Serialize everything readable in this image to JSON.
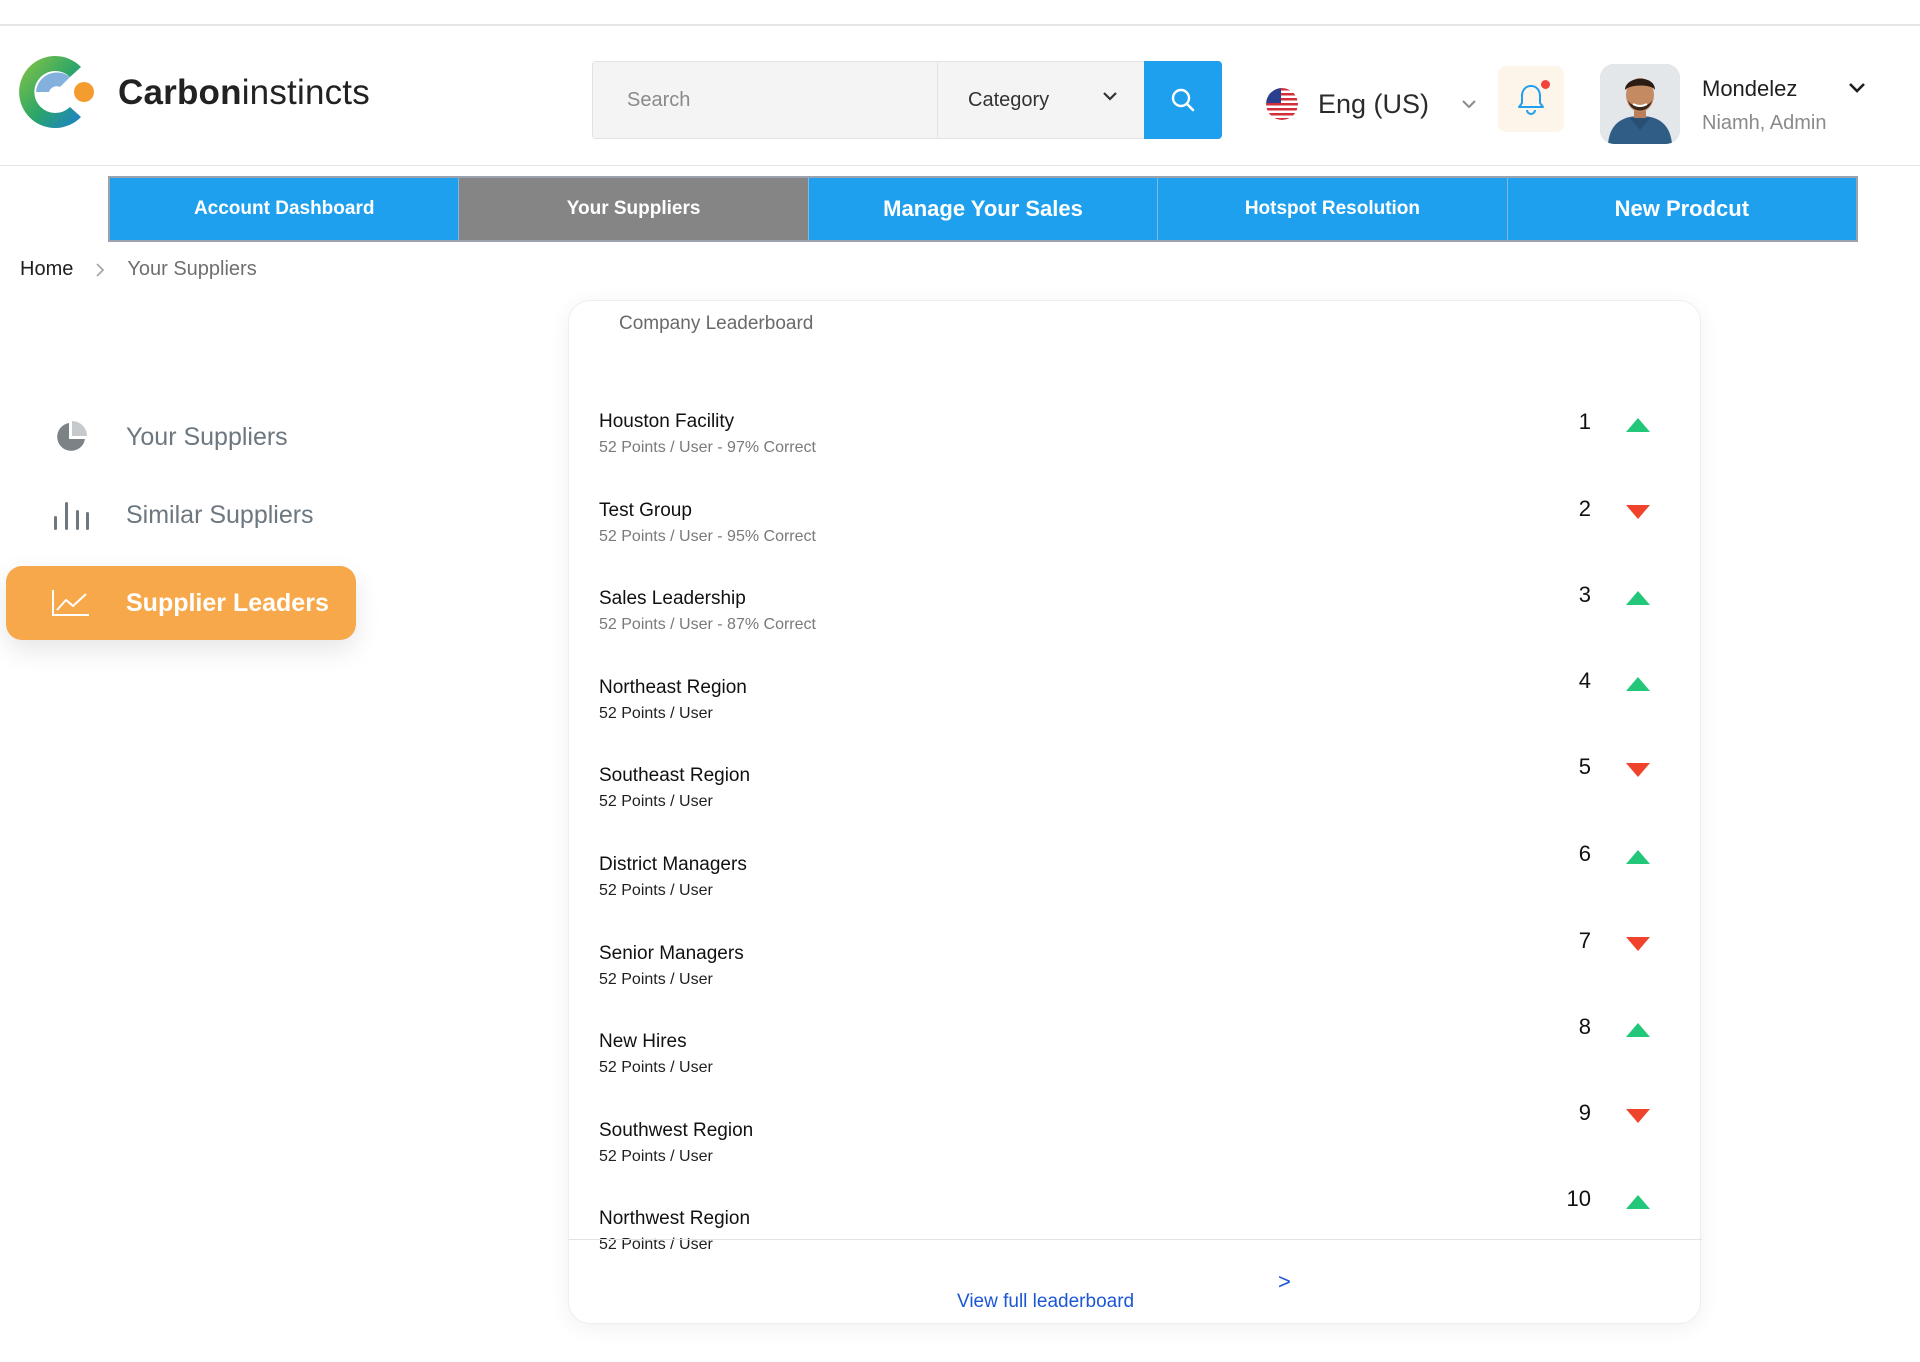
{
  "brand": {
    "name_bold": "Carbon",
    "name_light": "instincts"
  },
  "search": {
    "placeholder": "Search",
    "category_label": "Category"
  },
  "language": {
    "label": "Eng (US)"
  },
  "user": {
    "name": "Mondelez",
    "role": "Niamh, Admin"
  },
  "nav": {
    "tabs": [
      {
        "label": "Account Dashboard",
        "active": false
      },
      {
        "label": "Your Suppliers",
        "active": true
      },
      {
        "label": "Manage Your Sales",
        "active": false
      },
      {
        "label": "Hotspot Resolution",
        "active": false
      },
      {
        "label": "New Prodcut",
        "active": false
      }
    ]
  },
  "breadcrumb": {
    "home": "Home",
    "separator": ">",
    "current": "Your Suppliers"
  },
  "sidebar": {
    "items": [
      {
        "label": "Your Suppliers",
        "icon": "pie-chart-icon",
        "active": false
      },
      {
        "label": "Similar Suppliers",
        "icon": "bar-chart-icon",
        "active": false
      },
      {
        "label": "Supplier Leaders",
        "icon": "line-chart-icon",
        "active": true
      }
    ]
  },
  "leaderboard": {
    "title": "Company Leaderboard",
    "rows": [
      {
        "name": "Houston Facility",
        "meta": "52 Points / User - 97% Correct",
        "rank": "1",
        "trend": "up"
      },
      {
        "name": "Test Group",
        "meta": "52 Points / User - 95% Correct",
        "rank": "2",
        "trend": "down"
      },
      {
        "name": "Sales Leadership",
        "meta": "52 Points / User -  87% Correct",
        "rank": "3",
        "trend": "up"
      },
      {
        "name": "Northeast Region",
        "meta": "52 Points / User",
        "rank": "4",
        "trend": "up"
      },
      {
        "name": "Southeast Region",
        "meta": "52 Points / User",
        "rank": "5",
        "trend": "down"
      },
      {
        "name": "District Managers",
        "meta": "52 Points / User",
        "rank": "6",
        "trend": "up"
      },
      {
        "name": "Senior Managers",
        "meta": "52 Points / User",
        "rank": "7",
        "trend": "down"
      },
      {
        "name": "New Hires",
        "meta": "52 Points / User",
        "rank": "8",
        "trend": "up"
      },
      {
        "name": "Southwest Region",
        "meta": "52 Points / User",
        "rank": "9",
        "trend": "down"
      },
      {
        "name": "Northwest Region",
        "meta": "52 Points / User",
        "rank": "10",
        "trend": "up"
      }
    ],
    "view_all": "View full leaderboard",
    "view_all_chevron": ">"
  },
  "colors": {
    "primary": "#1fa0ee",
    "active_tab": "#858585",
    "accent": "#f7a84a",
    "trend_up": "#22c77a",
    "trend_down": "#f0432c",
    "link": "#1a56d6"
  }
}
